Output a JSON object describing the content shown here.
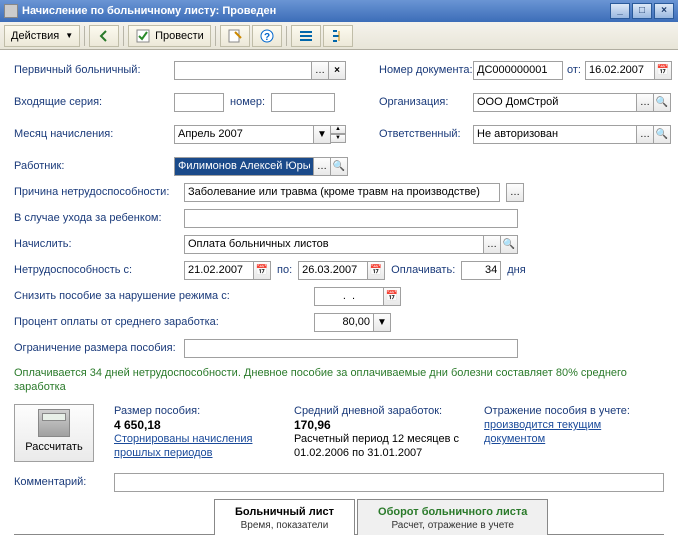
{
  "window": {
    "title": "Начисление по больничному листу: Проведен"
  },
  "toolbar": {
    "actions_label": "Действия",
    "conduct_label": "Провести"
  },
  "labels": {
    "primary_sick": "Первичный больничный:",
    "incoming_series": "Входящие серия:",
    "number": "номер:",
    "accrual_month": "Месяц начисления:",
    "employee": "Работник:",
    "disability_reason": "Причина нетрудоспособности:",
    "child_care": "В случае ухода за ребенком:",
    "accrue": "Начислить:",
    "disability_from": "Нетрудоспособность с:",
    "to": "по:",
    "pay_for": "Оплачивать:",
    "days": "дня",
    "reduce_benefit": "Снизить пособие за нарушение режима с:",
    "percent_pay": "Процент оплаты от среднего заработка:",
    "benefit_limit": "Ограничение размера пособия:",
    "doc_number": "Номер документа:",
    "from_date": "от:",
    "organization": "Организация:",
    "responsible": "Ответственный:",
    "comment": "Комментарий:"
  },
  "values": {
    "primary_sick": "",
    "incoming_series": "",
    "incoming_number": "",
    "accrual_month": "Апрель 2007",
    "employee": "Филимонов Алексей Юрьевич",
    "disability_reason": "Заболевание или травма (кроме травм на производстве)",
    "child_care": "",
    "accrue": "Оплата больничных листов",
    "date_from": "21.02.2007",
    "date_to": "26.03.2007",
    "days_count": "34",
    "reduce_from": ".  .",
    "percent": "80,00",
    "benefit_limit": "",
    "doc_number": "ДС000000001",
    "doc_date": "16.02.2007",
    "organization": "ООО ДомСтрой",
    "responsible": "Не авторизован",
    "comment": ""
  },
  "info_text": "Оплачивается 34 дней нетрудоспособности. Дневное пособие за оплачиваемые дни болезни составляет 80% среднего заработка",
  "calc": {
    "button_label": "Рассчитать",
    "benefit_size_label": "Размер пособия:",
    "benefit_size_value": "4 650,18",
    "reversed_link": "Сторнированы начисления прошлых периодов",
    "avg_daily_label": "Средний дневной заработок:",
    "avg_daily_value": "170,96",
    "calc_period": "Расчетный период 12 месяцев с 01.02.2006 по 31.01.2007",
    "reflection_label": "Отражение пособия в учете:",
    "reflection_link": "производится текущим документом"
  },
  "tabs": {
    "tab1_title": "Больничный лист",
    "tab1_sub": "Время, показатели",
    "tab2_title": "Оборот больничного листа",
    "tab2_sub": "Расчет, отражение в учете"
  }
}
